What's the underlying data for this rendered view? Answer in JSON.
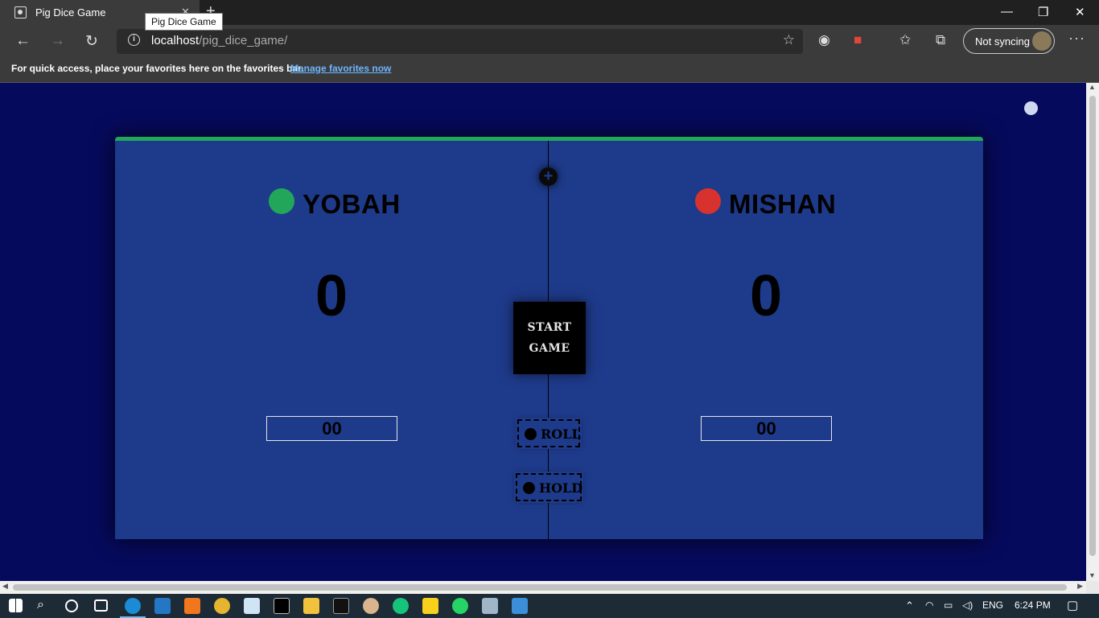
{
  "browser": {
    "tab_title": "Pig Dice Game",
    "tooltip": "Pig Dice Game",
    "url_host": "localhost",
    "url_path": "/pig_dice_game/",
    "sync_label": "Not syncing",
    "favorites_message": "For quick access, place your favorites here on the favorites bar.",
    "favorites_link": "Manage favorites now"
  },
  "game": {
    "player1": {
      "name": "YOBAH",
      "score": "0",
      "current": "00",
      "color": "#22a75a"
    },
    "player2": {
      "name": "MISHAN",
      "score": "0",
      "current": "00",
      "color": "#d8322e"
    },
    "start_line1": "START",
    "start_line2": "GAME",
    "roll_label": "ROLL",
    "hold_label": "HOLD",
    "board_accent": "#22a75a"
  },
  "taskbar": {
    "language": "ENG",
    "time": "6:24 PM"
  }
}
